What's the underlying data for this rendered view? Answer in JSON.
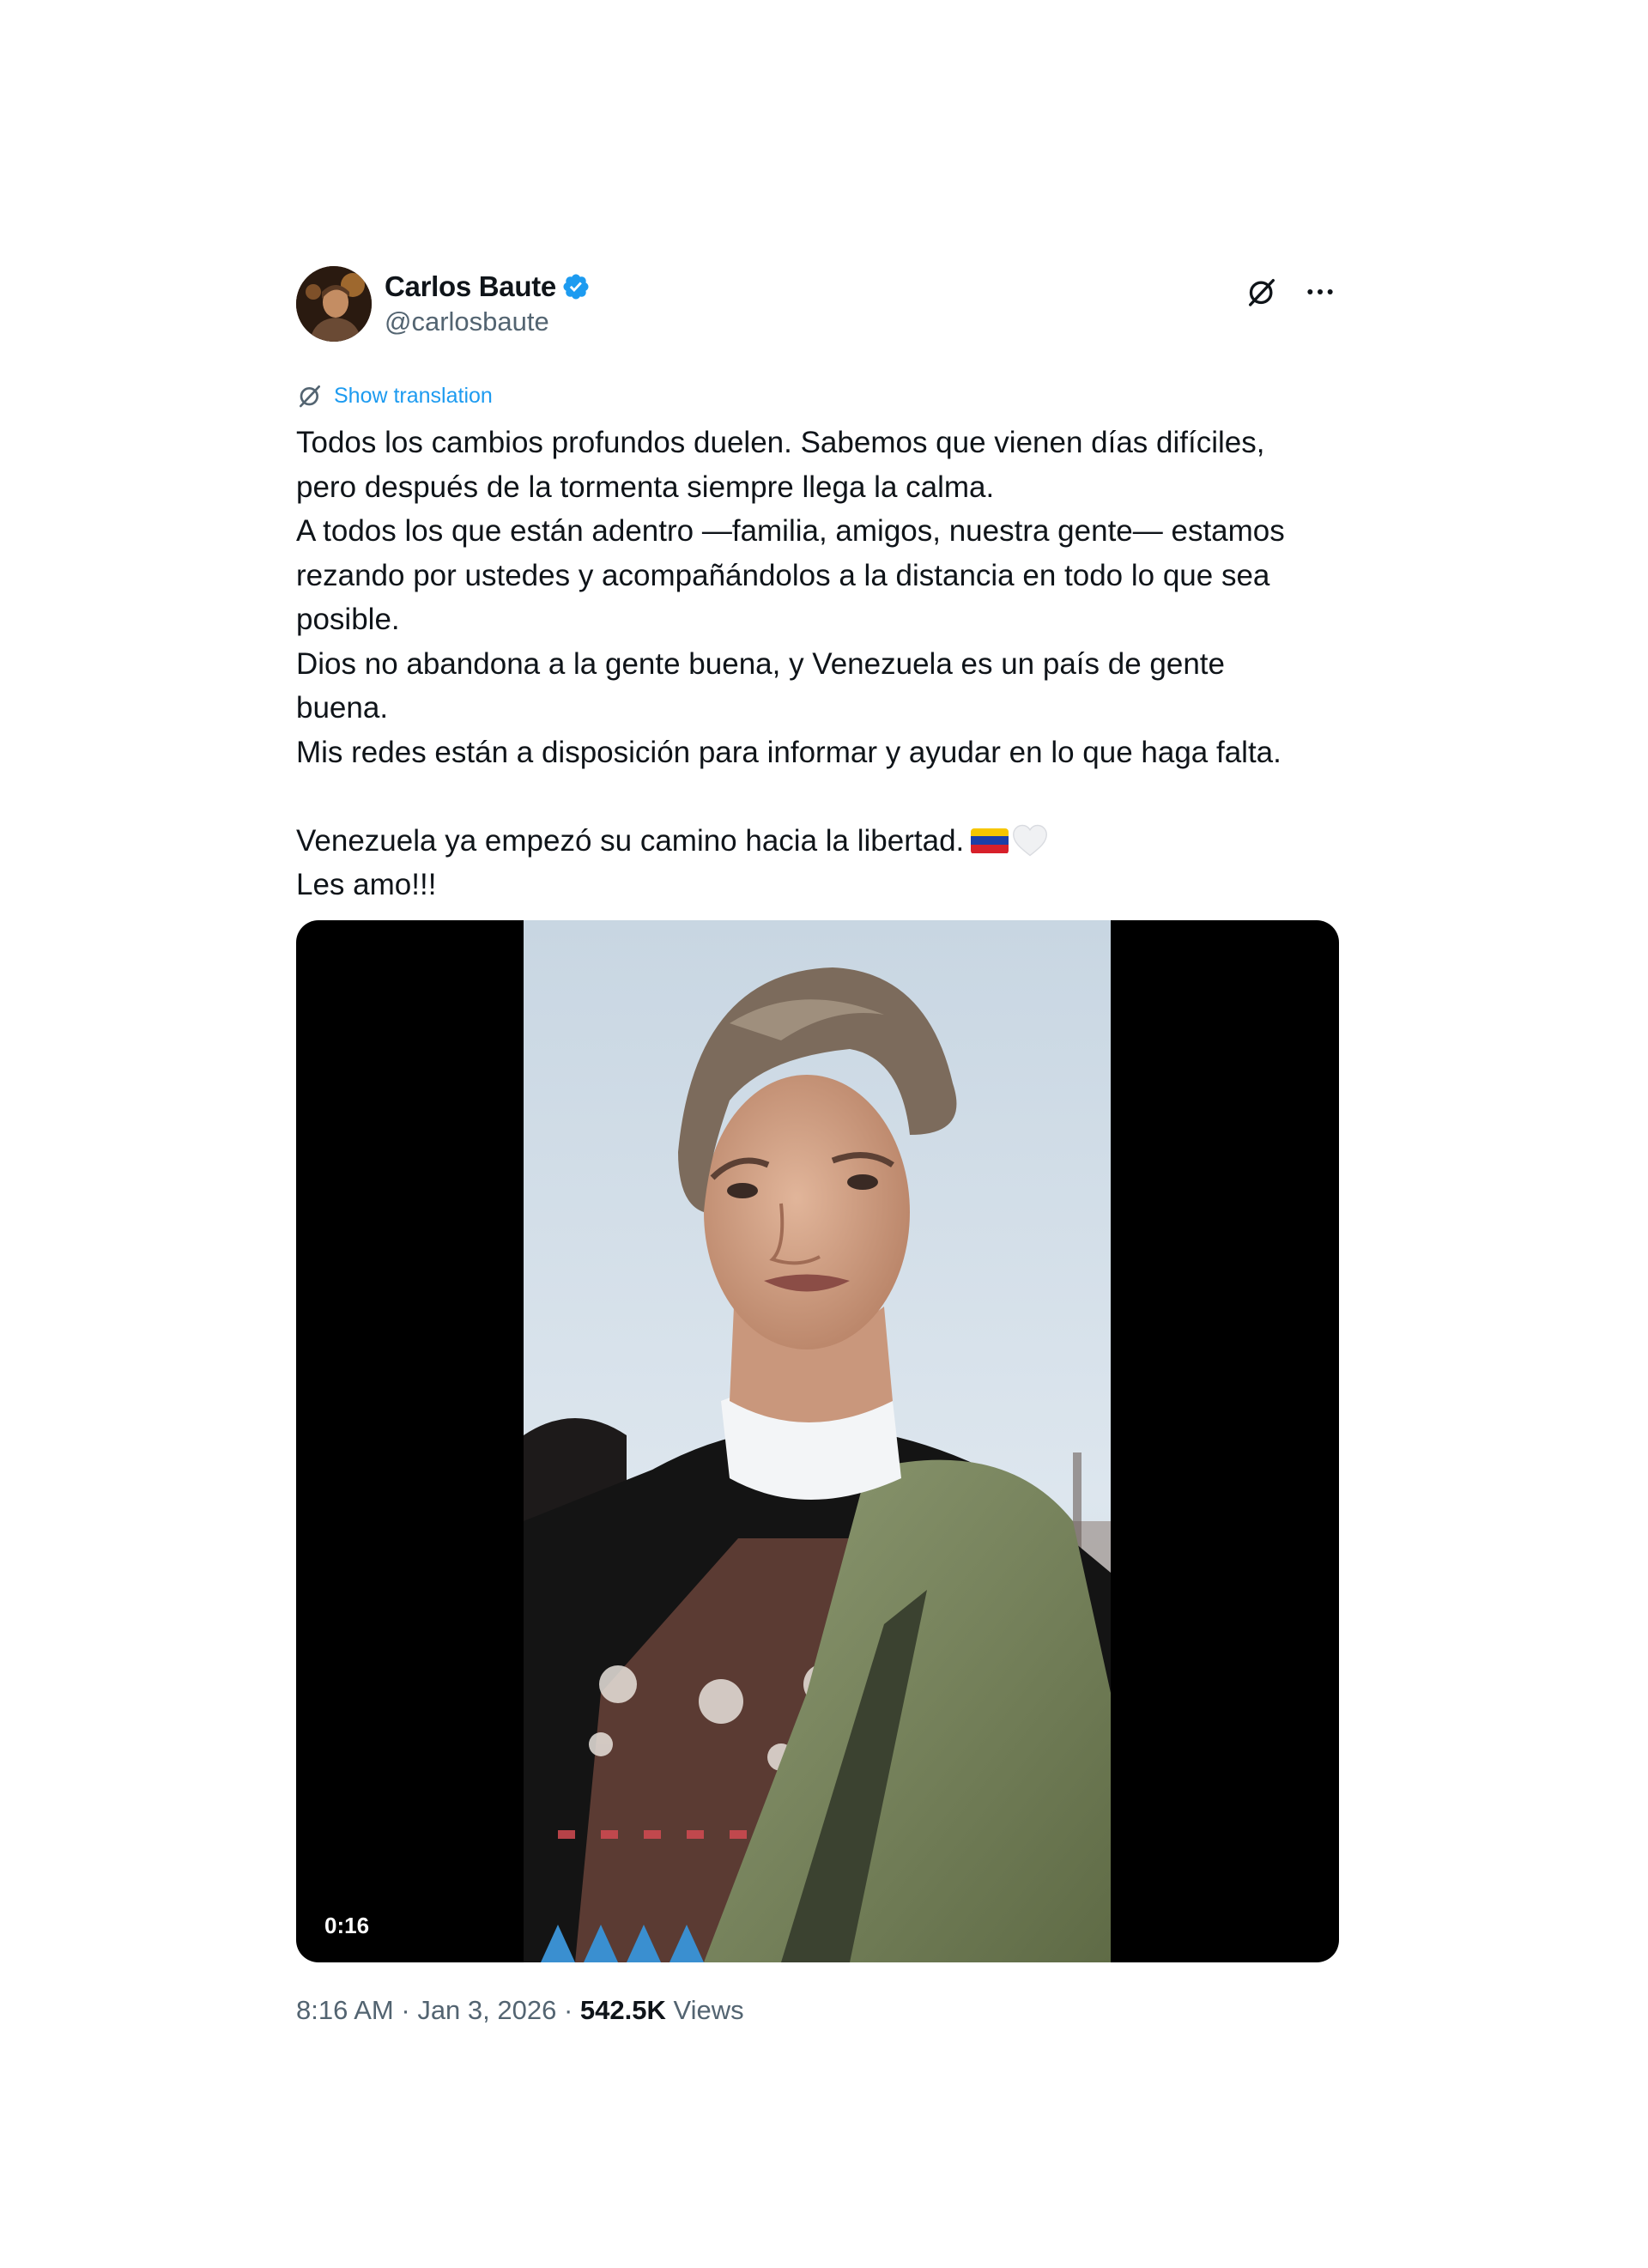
{
  "author": {
    "name": "Carlos Baute",
    "handle": "@carlosbaute",
    "verified": true,
    "avatar_icon": "profile-photo"
  },
  "header_actions": {
    "grok_icon": "grok-icon",
    "more_icon": "more-dots-icon"
  },
  "translate": {
    "label": "Show translation",
    "icon": "translate-icon"
  },
  "post": {
    "text": "Todos los cambios profundos duelen. Sabemos que vienen días difíciles,\npero después de la tormenta siempre llega la calma.\nA todos los que están adentro —familia, amigos, nuestra gente— estamos\nrezando por ustedes y acompañándolos a la distancia en todo lo que sea\nposible.\nDios no abandona a la gente buena, y Venezuela es un país de gente\nbuena.\nMis redes están a disposición para informar y ayudar en lo que haga falta.\n\nVenezuela ya empezó su camino hacia la libertad.",
    "closing": "Les amo!!!",
    "emojis": [
      "venezuela-flag-emoji",
      "white-heart-emoji"
    ]
  },
  "media": {
    "type": "video",
    "duration": "0:16"
  },
  "meta": {
    "time": "8:16 AM",
    "separator": " · ",
    "date": "Jan 3, 2026",
    "views_count": "542.5K",
    "views_label": " Views"
  },
  "colors": {
    "accent": "#1d9bf0",
    "secondary_text": "#536471",
    "primary_text": "#0f1419",
    "media_bg": "#000000"
  }
}
